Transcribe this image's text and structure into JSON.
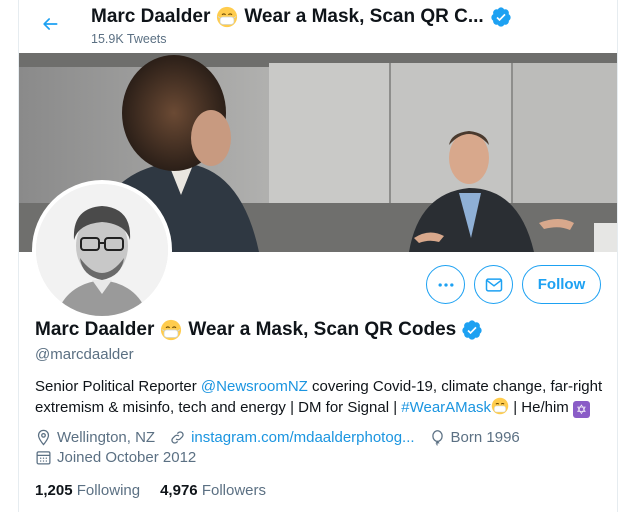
{
  "header": {
    "title_name": "Marc Daalder",
    "title_rest": "Wear a Mask, Scan QR C...",
    "tweet_count": "15.9K Tweets"
  },
  "profile": {
    "name": "Marc Daalder",
    "name_rest": "Wear a Mask, Scan QR Codes",
    "handle": "@marcdaalder",
    "bio": {
      "part1": "Senior Political Reporter ",
      "mention": "@NewsroomNZ",
      "part2": " covering Covid-19, climate change, far-right extremism & misinfo, tech and energy | DM for Signal | ",
      "hashtag": "#WearAMask",
      "part3": " | He/him "
    },
    "location": "Wellington, NZ",
    "website": "instagram.com/mdaalderphotog...",
    "born": "Born 1996",
    "joined": "Joined October 2012",
    "following_count": "1,205",
    "following_label": "Following",
    "followers_count": "4,976",
    "followers_label": "Followers"
  },
  "actions": {
    "follow_label": "Follow"
  },
  "colors": {
    "accent": "#1da1f2",
    "link": "#1b95e0",
    "muted": "#5b7083",
    "verified": "#1da1f2"
  },
  "icons": [
    "back-arrow-icon",
    "mask-emoji-icon",
    "verified-badge-icon",
    "more-icon",
    "mail-icon",
    "location-icon",
    "link-icon",
    "balloon-icon",
    "calendar-icon",
    "star-of-david-icon"
  ]
}
